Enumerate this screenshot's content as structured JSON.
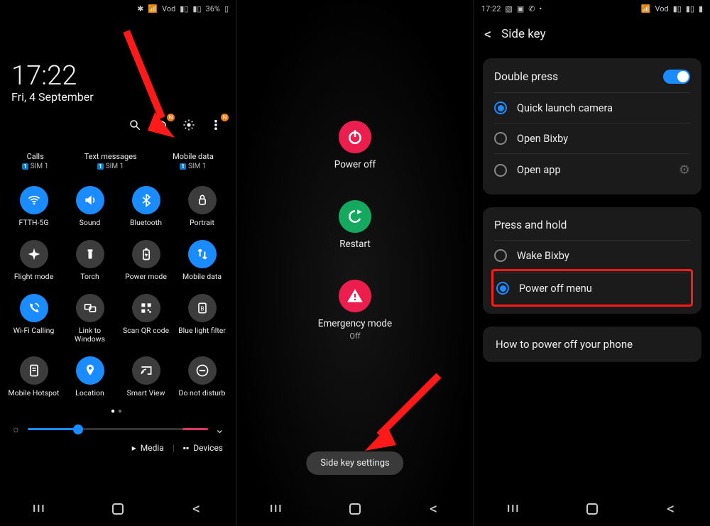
{
  "panel1": {
    "status": {
      "battery_pct": "36%",
      "vod_label": "Vod"
    },
    "clock": {
      "time": "17:22",
      "date": "Fri, 4 September"
    },
    "sim_row": [
      {
        "title": "Calls",
        "sub": "SIM 1"
      },
      {
        "title": "Text messages",
        "sub": "SIM 1"
      },
      {
        "title": "Mobile data",
        "sub": "SIM 1"
      }
    ],
    "tiles": [
      {
        "id": "wifi",
        "label": "FTTH-5G",
        "on": true,
        "icon": "wifi"
      },
      {
        "id": "sound",
        "label": "Sound",
        "on": true,
        "icon": "sound"
      },
      {
        "id": "bluetooth",
        "label": "Bluetooth",
        "on": true,
        "icon": "bt"
      },
      {
        "id": "portrait",
        "label": "Portrait",
        "on": false,
        "icon": "lock"
      },
      {
        "id": "flight",
        "label": "Flight mode",
        "on": false,
        "icon": "plane"
      },
      {
        "id": "torch",
        "label": "Torch",
        "on": false,
        "icon": "torch"
      },
      {
        "id": "power-mode",
        "label": "Power mode",
        "on": false,
        "icon": "battery"
      },
      {
        "id": "mobile-data",
        "label": "Mobile data",
        "on": true,
        "icon": "mdata"
      },
      {
        "id": "wifi-calling",
        "label": "Wi-Fi Calling",
        "on": true,
        "icon": "wificall"
      },
      {
        "id": "link",
        "label": "Link to Windows",
        "on": false,
        "icon": "link"
      },
      {
        "id": "qr",
        "label": "Scan QR code",
        "on": false,
        "icon": "qr"
      },
      {
        "id": "bluelight",
        "label": "Blue light filter",
        "on": false,
        "icon": "bl"
      },
      {
        "id": "hotspot",
        "label": "Mobile Hotspot",
        "on": false,
        "icon": "doc"
      },
      {
        "id": "location",
        "label": "Location",
        "on": true,
        "icon": "pin"
      },
      {
        "id": "smartview",
        "label": "Smart View",
        "on": false,
        "icon": "cast"
      },
      {
        "id": "dnd",
        "label": "Do not disturb",
        "on": false,
        "icon": "dnd"
      }
    ],
    "bottom": {
      "media": "Media",
      "devices": "Devices"
    }
  },
  "panel2": {
    "items": [
      {
        "id": "power-off",
        "label": "Power off",
        "color": "red",
        "icon": "power"
      },
      {
        "id": "restart",
        "label": "Restart",
        "color": "green",
        "icon": "restart"
      },
      {
        "id": "emergency",
        "label": "Emergency mode",
        "sub": "Off",
        "color": "red",
        "icon": "emerg"
      }
    ],
    "pill": "Side key settings"
  },
  "panel3": {
    "status_time": "17:22",
    "header": "Side key",
    "double_press": {
      "title": "Double press",
      "options": [
        {
          "id": "camera",
          "label": "Quick launch camera",
          "selected": true
        },
        {
          "id": "bixby",
          "label": "Open Bixby",
          "selected": false
        },
        {
          "id": "app",
          "label": "Open app",
          "selected": false,
          "gear": true
        }
      ]
    },
    "press_hold": {
      "title": "Press and hold",
      "options": [
        {
          "id": "wake-bixby",
          "label": "Wake Bixby",
          "selected": false
        },
        {
          "id": "power-menu",
          "label": "Power off menu",
          "selected": true,
          "highlight": true
        }
      ]
    },
    "info": "How to power off your phone"
  }
}
